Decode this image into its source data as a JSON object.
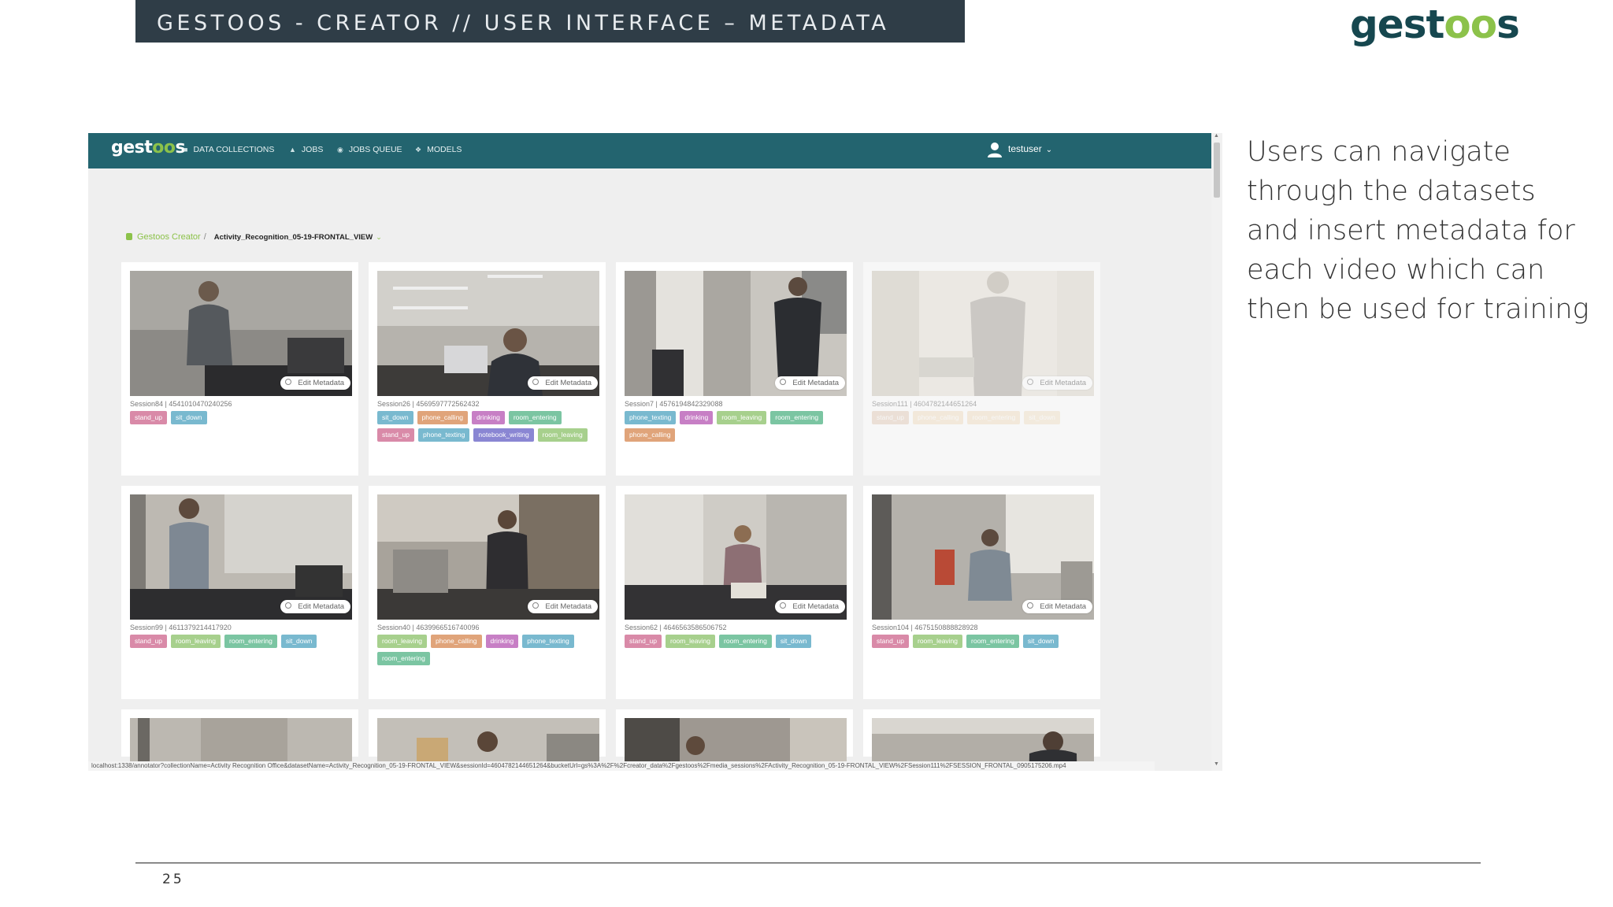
{
  "slide": {
    "banner_title": "GESTOOS - CREATOR // USER INTERFACE – METADATA",
    "logo_text_a": "gest",
    "logo_text_oo": "oo",
    "logo_text_b": "s",
    "description": "Users can navigate through the datasets and insert metadata for each video which can then be used for training",
    "page_number": "25"
  },
  "app": {
    "logo_a": "gest",
    "logo_oo": "oo",
    "logo_b": "s",
    "nav": [
      {
        "label": "DATA COLLECTIONS",
        "icon": "database-icon"
      },
      {
        "label": "JOBS",
        "icon": "flask-icon"
      },
      {
        "label": "JOBS QUEUE",
        "icon": "queue-icon"
      },
      {
        "label": "MODELS",
        "icon": "model-icon"
      }
    ],
    "user": "testuser",
    "breadcrumb": {
      "root": "Gestoos Creator",
      "separator": "/",
      "current": "Activity_Recognition_05-19-FRONTAL_VIEW"
    },
    "edit_label": "Edit Metadata",
    "status_url": "localhost:1338/annotator?collectionName=Activity Recognition Office&datasetName=Activity_Recognition_05-19-FRONTAL_VIEW&sessionId=4604782144651264&bucketUrl=gs%3A%2F%2Fcreator_data%2Fgestoos%2Fmedia_sessions%2FActivity_Recognition_05-19-FRONTAL_VIEW%2FSession111%2FSESSION_FRONTAL_0905175206.mp4",
    "colors": {
      "nav": "#23646f",
      "accent": "#8cc24a",
      "tag_stand_up": "#d98aa8",
      "tag_sit_down": "#79b9cf",
      "tag_phone_calling": "#e0a47a",
      "tag_drinking": "#c77fc5",
      "tag_room": "#7bc5a2",
      "tag_notebook": "#8a86d3"
    },
    "sessions": [
      {
        "title": "Session84 | 4541010470240256",
        "tags": [
          "stand_up",
          "sit_down"
        ]
      },
      {
        "title": "Session26 | 4569597772562432",
        "tags": [
          "sit_down",
          "phone_calling",
          "drinking",
          "room_entering",
          "stand_up",
          "phone_texting",
          "notebook_writing",
          "room_leaving"
        ]
      },
      {
        "title": "Session7 | 4576194842329088",
        "tags": [
          "phone_texting",
          "drinking",
          "room_leaving",
          "room_entering",
          "phone_calling"
        ]
      },
      {
        "title": "Session111 | 4604782144651264",
        "tags": [
          "stand_up",
          "phone_calling",
          "room_entering",
          "sit_down"
        ]
      },
      {
        "title": "Session99 | 4611379214417920",
        "tags": [
          "stand_up",
          "room_leaving",
          "room_entering",
          "sit_down"
        ]
      },
      {
        "title": "Session40 | 4639966516740096",
        "tags": [
          "room_leaving",
          "phone_calling",
          "drinking",
          "phone_texting",
          "room_entering"
        ]
      },
      {
        "title": "Session62 | 4646563586506752",
        "tags": [
          "stand_up",
          "room_leaving",
          "room_entering",
          "sit_down"
        ]
      },
      {
        "title": "Session104 | 4675150888828928",
        "tags": [
          "stand_up",
          "room_leaving",
          "room_entering",
          "sit_down"
        ]
      }
    ]
  }
}
